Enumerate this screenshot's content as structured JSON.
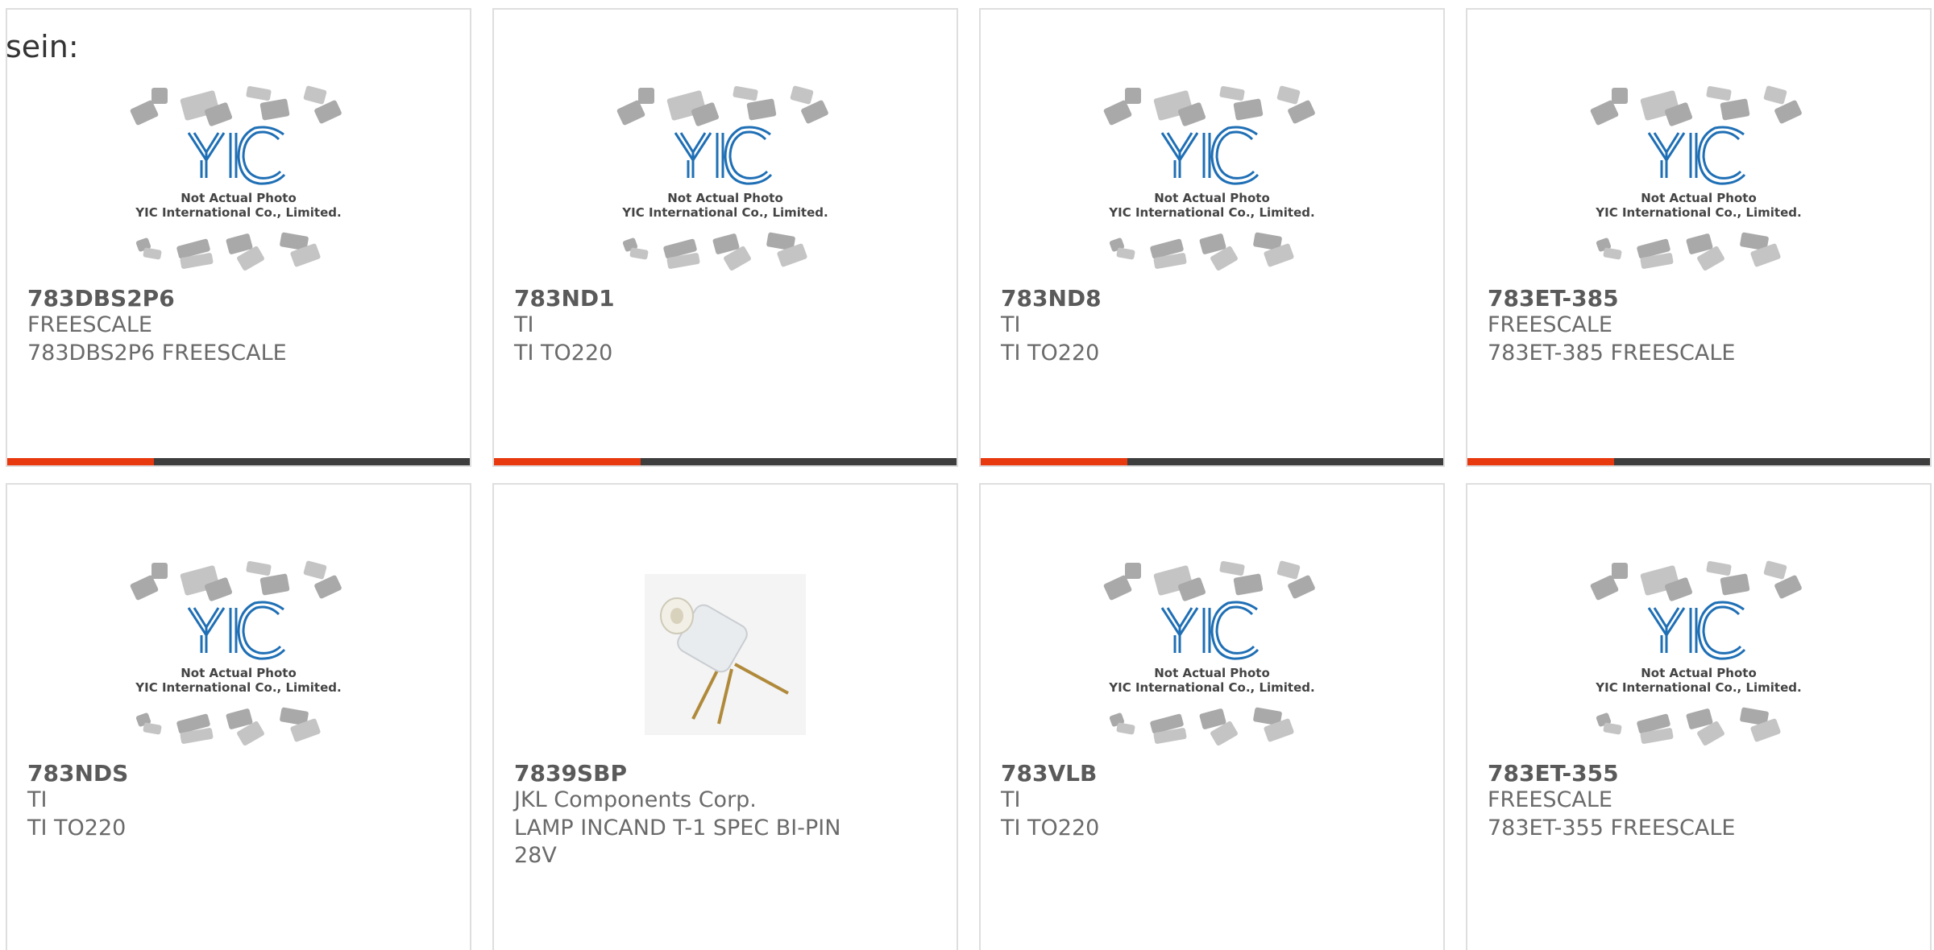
{
  "intro_text": "sein:",
  "logo": {
    "brand": "YIC",
    "line1": "Not Actual Photo",
    "line2": "YIC International Co., Limited."
  },
  "colors": {
    "accent": "#e8380d",
    "bar": "#3d3d3d",
    "logo_blue": "#1f6fb5"
  },
  "products": [
    {
      "part_number": "783DBS2P6",
      "manufacturer": "FREESCALE",
      "description": "783DBS2P6 FREESCALE",
      "image": "placeholder-logo"
    },
    {
      "part_number": "783ND1",
      "manufacturer": "TI",
      "description": "TI TO220",
      "image": "placeholder-logo"
    },
    {
      "part_number": "783ND8",
      "manufacturer": "TI",
      "description": "TI TO220",
      "image": "placeholder-logo"
    },
    {
      "part_number": "783ET-385",
      "manufacturer": "FREESCALE",
      "description": "783ET-385 FREESCALE",
      "image": "placeholder-logo"
    },
    {
      "part_number": "783NDS",
      "manufacturer": "TI",
      "description": "TI TO220",
      "image": "placeholder-logo"
    },
    {
      "part_number": "7839SBP",
      "manufacturer": "JKL Components Corp.",
      "description": "LAMP INCAND T-1 SPEC BI-PIN 28V",
      "image": "lamp-photo"
    },
    {
      "part_number": "783VLB",
      "manufacturer": "TI",
      "description": "TI TO220",
      "image": "placeholder-logo"
    },
    {
      "part_number": "783ET-355",
      "manufacturer": "FREESCALE",
      "description": "783ET-355 FREESCALE",
      "image": "placeholder-logo"
    }
  ]
}
